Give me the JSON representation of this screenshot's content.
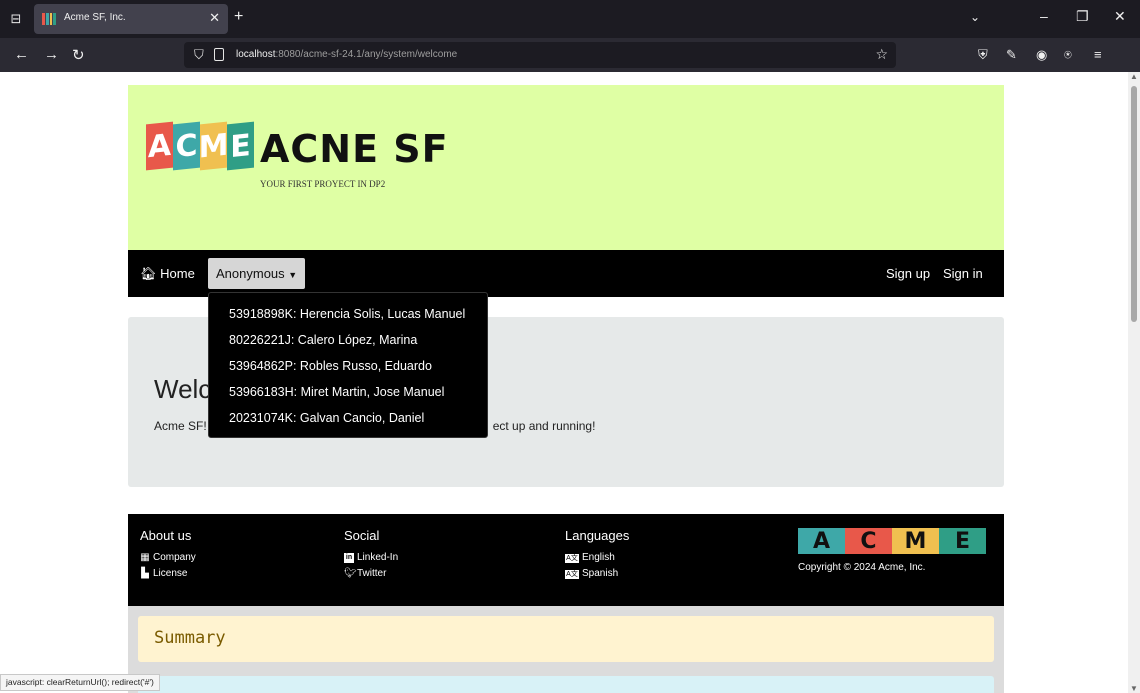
{
  "browser": {
    "tab_title": "Acme SF, Inc.",
    "url_host": "localhost",
    "url_rest": ":8080/acme-sf-24.1/any/system/welcome",
    "status_text": "javascript: clearReturnUrl(); redirect('#')"
  },
  "header": {
    "logo_letters": [
      "A",
      "C",
      "M",
      "E"
    ],
    "logo_colors": [
      "#e8584a",
      "#3ea8a8",
      "#f0c050",
      "#2f9e86"
    ],
    "title": "ACNE SF",
    "subtitle": "YOUR FIRST PROYECT IN DP2",
    "banner_color": "#dfffa4"
  },
  "nav": {
    "home": "Home",
    "user_menu": "Anonymous",
    "sign_up": "Sign up",
    "sign_in": "Sign in"
  },
  "dropdown": {
    "items": [
      "53918898K: Herencia Solis, Lucas Manuel",
      "80226221J: Calero López, Marina",
      "53964862P: Robles Russo, Eduardo",
      "53966183H: Miret Martin, Jose Manuel",
      "20231074K: Galvan Cancio, Daniel"
    ]
  },
  "welcome": {
    "heading": "Welc",
    "text_left": "Acme SF!",
    "text_right": "ect up and running!"
  },
  "footer": {
    "about": {
      "title": "About us",
      "links": [
        "Company",
        "License"
      ]
    },
    "social": {
      "title": "Social",
      "links": [
        "Linked-In",
        "Twitter"
      ]
    },
    "languages": {
      "title": "Languages",
      "links": [
        "English",
        "Spanish"
      ]
    },
    "logo_letters": [
      "A",
      "C",
      "M",
      "E"
    ],
    "logo_colors": [
      "#3ea8a8",
      "#e8584a",
      "#f0c050",
      "#2f9e86"
    ],
    "copyright": "Copyright © 2024 Acme, Inc."
  },
  "summary": {
    "title": "Summary"
  }
}
